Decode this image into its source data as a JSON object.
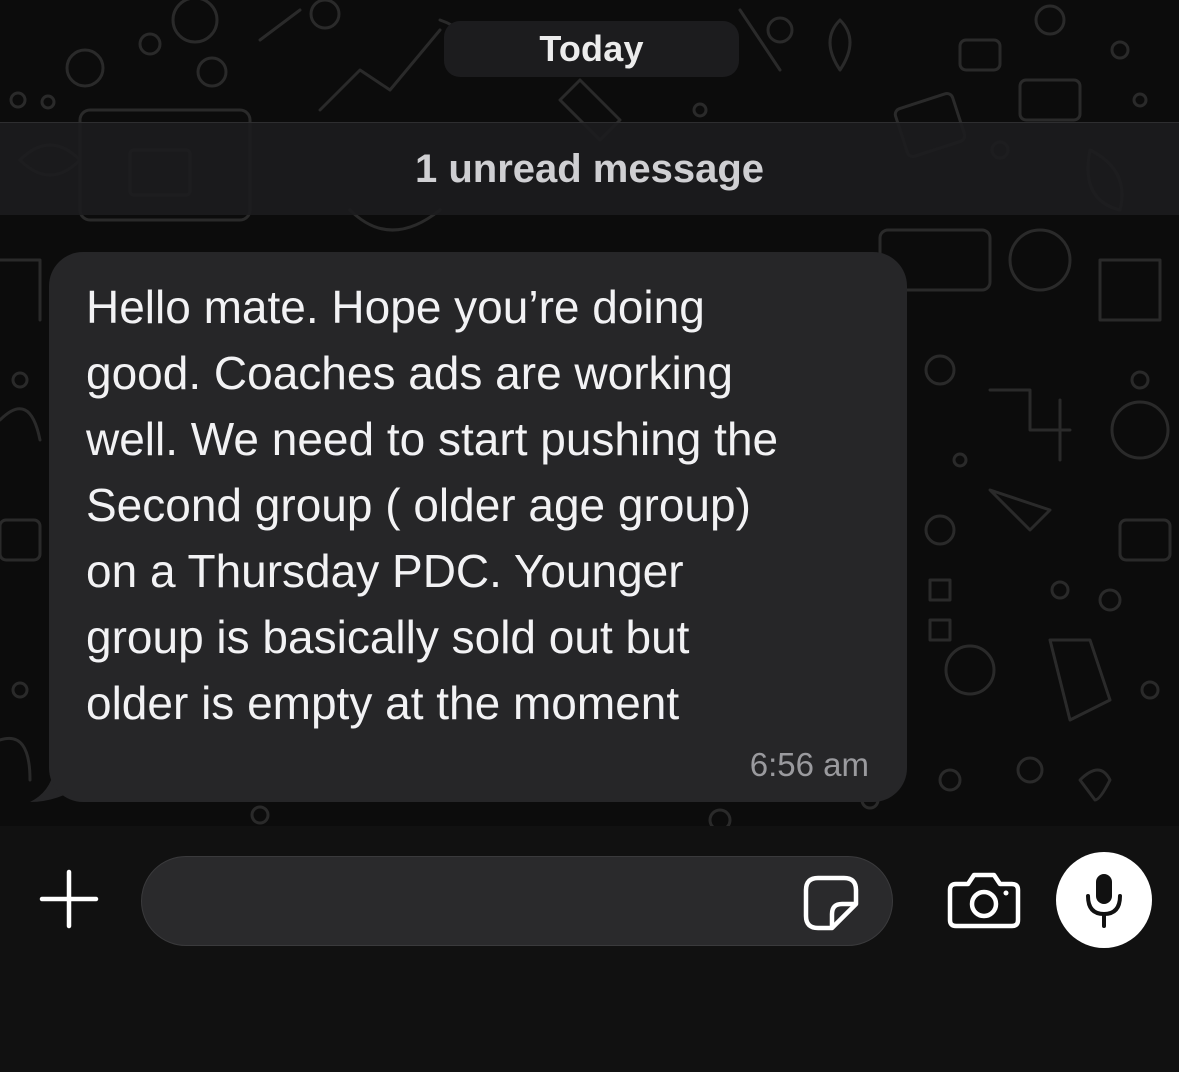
{
  "chat": {
    "date_separator": "Today",
    "unread_banner": "1 unread message",
    "messages": [
      {
        "direction": "incoming",
        "text": "Hello mate. Hope you’re doing\ngood. Coaches ads are working\nwell. We need to start pushing the\nSecond group ( older age group)\non a Thursday PDC. Younger\ngroup is basically sold out but\nolder is empty at the moment",
        "time": "6:56 am"
      }
    ]
  },
  "composer": {
    "input_value": "",
    "input_placeholder": "",
    "icons": {
      "attach": "plus-icon",
      "sticker": "sticker-icon",
      "camera": "camera-icon",
      "mic": "microphone-icon"
    }
  },
  "colors": {
    "background": "#0c0c0c",
    "bubble_incoming": "#262628",
    "text_primary": "#f2f2f4",
    "text_secondary": "#9a9a9e",
    "mic_button": "#ffffff"
  }
}
